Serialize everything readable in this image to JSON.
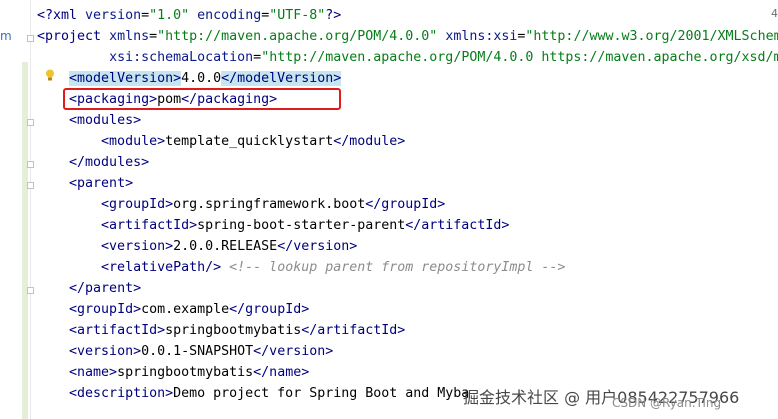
{
  "editor": {
    "gutter_mark": "m",
    "right_indicator": "4",
    "lines": [
      {
        "parts": [
          [
            "tag",
            "<?xml "
          ],
          [
            "attr",
            "version"
          ],
          [
            "",
            "="
          ],
          [
            "val",
            "\"1.0\""
          ],
          [
            "",
            " "
          ],
          [
            "attr",
            "encoding"
          ],
          [
            "",
            "="
          ],
          [
            "val",
            "\"UTF-8\""
          ],
          [
            "tag",
            "?>"
          ]
        ]
      },
      {
        "parts": [
          [
            "tag",
            "<project "
          ],
          [
            "attr",
            "xmlns"
          ],
          [
            "",
            "="
          ],
          [
            "val",
            "\"http://maven.apache.org/POM/4.0.0\""
          ],
          [
            "",
            " "
          ],
          [
            "attr",
            "xmlns:xsi"
          ],
          [
            "",
            "="
          ],
          [
            "val",
            "\"http://www.w3.org/2001/XMLSchem"
          ]
        ]
      },
      {
        "parts": [
          [
            "",
            "         "
          ],
          [
            "attr",
            "xsi:schemaLocation"
          ],
          [
            "",
            "="
          ],
          [
            "val",
            "\"http://maven.apache.org/POM/4.0.0 https://maven.apache.org/xsd/m"
          ]
        ]
      },
      {
        "parts": [
          [
            "",
            "    "
          ],
          [
            "tag match",
            "<modelVersion>"
          ],
          [
            "",
            "4.0.0"
          ],
          [
            "tag match",
            "</modelVersion>"
          ]
        ]
      },
      {
        "parts": [
          [
            "",
            "    "
          ],
          [
            "tag",
            "<packaging>"
          ],
          [
            "",
            "pom"
          ],
          [
            "tag",
            "</packaging>"
          ]
        ]
      },
      {
        "parts": [
          [
            "",
            "    "
          ],
          [
            "tag",
            "<modules>"
          ]
        ]
      },
      {
        "parts": [
          [
            "",
            "        "
          ],
          [
            "tag",
            "<module>"
          ],
          [
            "",
            "template_quicklystart"
          ],
          [
            "tag",
            "</module>"
          ]
        ]
      },
      {
        "parts": [
          [
            "",
            "    "
          ],
          [
            "tag",
            "</modules>"
          ]
        ]
      },
      {
        "parts": [
          [
            "",
            "    "
          ],
          [
            "tag",
            "<parent>"
          ]
        ]
      },
      {
        "parts": [
          [
            "",
            "        "
          ],
          [
            "tag",
            "<groupId>"
          ],
          [
            "",
            "org.springframework.boot"
          ],
          [
            "tag",
            "</groupId>"
          ]
        ]
      },
      {
        "parts": [
          [
            "",
            "        "
          ],
          [
            "tag",
            "<artifactId>"
          ],
          [
            "",
            "spring-boot-starter-parent"
          ],
          [
            "tag",
            "</artifactId>"
          ]
        ]
      },
      {
        "parts": [
          [
            "",
            "        "
          ],
          [
            "tag",
            "<version>"
          ],
          [
            "",
            "2.0.0.RELEASE"
          ],
          [
            "tag",
            "</version>"
          ]
        ]
      },
      {
        "parts": [
          [
            "",
            "        "
          ],
          [
            "tag",
            "<relativePath/>"
          ],
          [
            "",
            " "
          ],
          [
            "comment",
            "<!-- lookup parent from repositoryImpl -->"
          ]
        ]
      },
      {
        "parts": [
          [
            "",
            "    "
          ],
          [
            "tag",
            "</parent>"
          ]
        ]
      },
      {
        "parts": [
          [
            "",
            "    "
          ],
          [
            "tag",
            "<groupId>"
          ],
          [
            "",
            "com.example"
          ],
          [
            "tag",
            "</groupId>"
          ]
        ]
      },
      {
        "parts": [
          [
            "",
            "    "
          ],
          [
            "tag",
            "<artifactId>"
          ],
          [
            "",
            "springbootmybatis"
          ],
          [
            "tag",
            "</artifactId>"
          ]
        ]
      },
      {
        "parts": [
          [
            "",
            "    "
          ],
          [
            "tag",
            "<version>"
          ],
          [
            "",
            "0.0.1-SNAPSHOT"
          ],
          [
            "tag",
            "</version>"
          ]
        ]
      },
      {
        "parts": [
          [
            "",
            "    "
          ],
          [
            "tag",
            "<name>"
          ],
          [
            "",
            "springbootmybatis"
          ],
          [
            "tag",
            "</name>"
          ]
        ]
      },
      {
        "parts": [
          [
            "",
            "    "
          ],
          [
            "tag",
            "<description>"
          ],
          [
            "",
            "Demo project for Spring Boot and Myba"
          ]
        ]
      }
    ]
  },
  "watermark": {
    "primary": "掘金技术社区 @ 用户085422757966",
    "secondary": "CSDN @Ryan.Ting"
  }
}
